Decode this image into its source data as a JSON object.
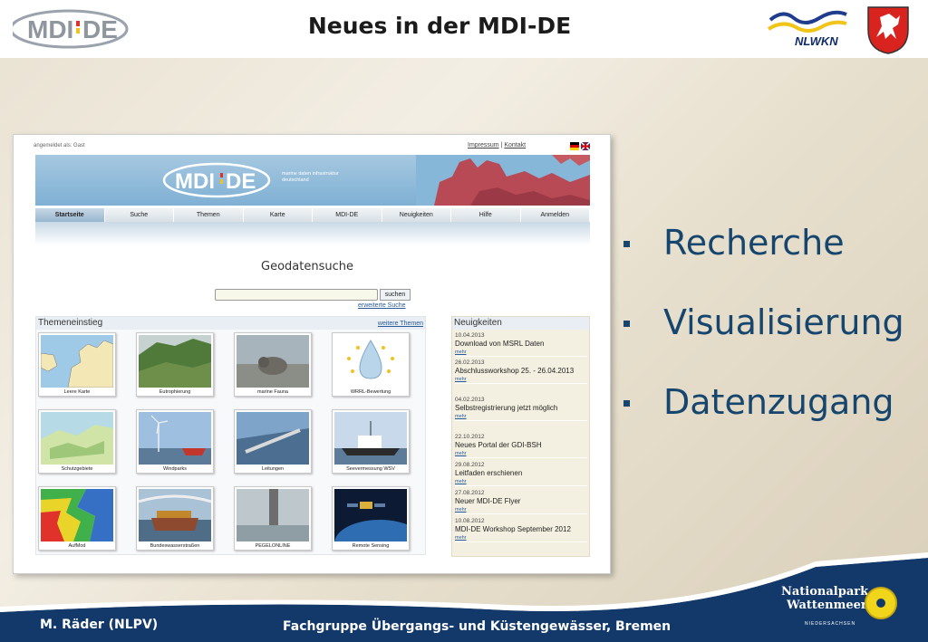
{
  "header": {
    "title": "Neues in  der MDI-DE",
    "logo_left_text": "MDI-DE",
    "logo_right_text": "NLWKN"
  },
  "screenshot": {
    "logged_in": "angemeldet als:  Gast",
    "links": [
      "Impressum",
      "Kontakt"
    ],
    "banner_logo": "MDI-DE",
    "banner_sub": "marine daten infrastruktur\ndeutschland",
    "nav": [
      "Startseite",
      "Suche",
      "Themen",
      "Karte",
      "MDI-DE",
      "Neuigkeiten",
      "Hilfe",
      "Anmelden"
    ],
    "search_title": "Geodatensuche",
    "search_button": "suchen",
    "search_extended": "erweiterte Suche",
    "themes_title": "Themeneinstieg",
    "themes_more": "weitere Themen",
    "tiles": [
      {
        "label": "Leere Karte"
      },
      {
        "label": "Eutrophierung"
      },
      {
        "label": "marine Fauna"
      },
      {
        "label": "WRRL-Bewertung"
      },
      {
        "label": "Schutzgebiete"
      },
      {
        "label": "Windparks"
      },
      {
        "label": "Leitungen"
      },
      {
        "label": "Seevermessung WSV"
      },
      {
        "label": "AufMod"
      },
      {
        "label": "Bundeswasserstraßen"
      },
      {
        "label": "PEGELONLINE"
      },
      {
        "label": "Remote Sensing"
      }
    ],
    "news_title": "Neuigkeiten",
    "news": [
      {
        "date": "10.04.2013",
        "text": "Download von MSRL Daten",
        "more": "mehr"
      },
      {
        "date": "26.02.2013",
        "text": "Abschlussworkshop 25. - 26.04.2013",
        "more": "mehr"
      },
      {
        "date": "04.02.2013",
        "text": "Selbstregistrierung jetzt möglich",
        "more": "mehr"
      },
      {
        "date": "22.10.2012",
        "text": "Neues Portal der GDI-BSH",
        "more": "mehr"
      },
      {
        "date": "29.08.2012",
        "text": "Leitfaden erschienen",
        "more": "mehr"
      },
      {
        "date": "27.08.2012",
        "text": "Neuer MDI-DE Flyer",
        "more": "mehr"
      },
      {
        "date": "10.08.2012",
        "text": "MDI-DE Workshop September 2012",
        "more": "mehr"
      }
    ]
  },
  "bullets": [
    "Recherche",
    "Visualisierung",
    "Datenzugang"
  ],
  "footer": {
    "author": "M. Räder (NLPV)",
    "group": "Fachgruppe Übergangs- und Küstengewässer, Bremen",
    "np_line1": "Nationalpark",
    "np_line2": "Wattenmeer",
    "np_line3": "NIEDERSACHSEN"
  },
  "colors": {
    "accent_blue": "#16466e",
    "footer_blue": "#12396a",
    "nav_active": "#97b6cf"
  }
}
